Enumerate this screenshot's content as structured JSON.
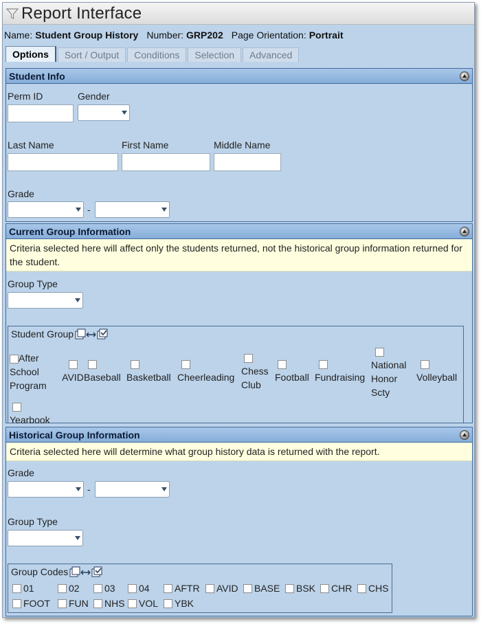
{
  "window": {
    "title": "Report Interface"
  },
  "info": {
    "name_label": "Name:",
    "name_value": "Student Group History",
    "number_label": "Number:",
    "number_value": "GRP202",
    "orientation_label": "Page Orientation:",
    "orientation_value": "Portrait"
  },
  "tabs": [
    {
      "label": "Options",
      "active": true
    },
    {
      "label": "Sort / Output"
    },
    {
      "label": "Conditions"
    },
    {
      "label": "Selection"
    },
    {
      "label": "Advanced"
    }
  ],
  "student_info": {
    "header": "Student Info",
    "perm_id_label": "Perm ID",
    "perm_id_value": "",
    "gender_label": "Gender",
    "gender_value": "",
    "last_name_label": "Last Name",
    "first_name_label": "First Name",
    "middle_name_label": "Middle Name",
    "grade_label": "Grade",
    "grade_from": "",
    "grade_to": "",
    "range_separator": "-"
  },
  "current_group": {
    "header": "Current Group Information",
    "note": "Criteria selected here will affect only the students returned, not the historical group information returned for the student.",
    "group_type_label": "Group Type",
    "group_type_value": "",
    "student_group_label": "Student Group",
    "groups": [
      "After School Program",
      "AVID",
      "Baseball",
      "Basketball",
      "Cheerleading",
      "Chess Club",
      "Football",
      "Fundraising",
      "National Honor Scty",
      "Volleyball",
      "Yearbook"
    ]
  },
  "historical_group": {
    "header": "Historical Group Information",
    "note": "Criteria selected here will determine what group history data is returned with the report.",
    "grade_label": "Grade",
    "grade_from": "",
    "grade_to": "",
    "range_separator": "-",
    "group_type_label": "Group Type",
    "group_type_value": "",
    "group_codes_label": "Group Codes",
    "codes": [
      "01",
      "02",
      "03",
      "04",
      "AFTR",
      "AVID",
      "BASE",
      "BSK",
      "CHR",
      "CHS",
      "FOOT",
      "FUN",
      "NHS",
      "VOL",
      "YBK"
    ]
  },
  "icons": {
    "title_icon": "filter-funnel-icon",
    "collapse": "collapse-up-icon",
    "toggle": "select-all-toggle-icon"
  },
  "colors": {
    "panel_bg": "#bcd3ea",
    "header_bg": "#86add9",
    "note_bg": "#ffffe0",
    "border": "#3f6a9b"
  }
}
